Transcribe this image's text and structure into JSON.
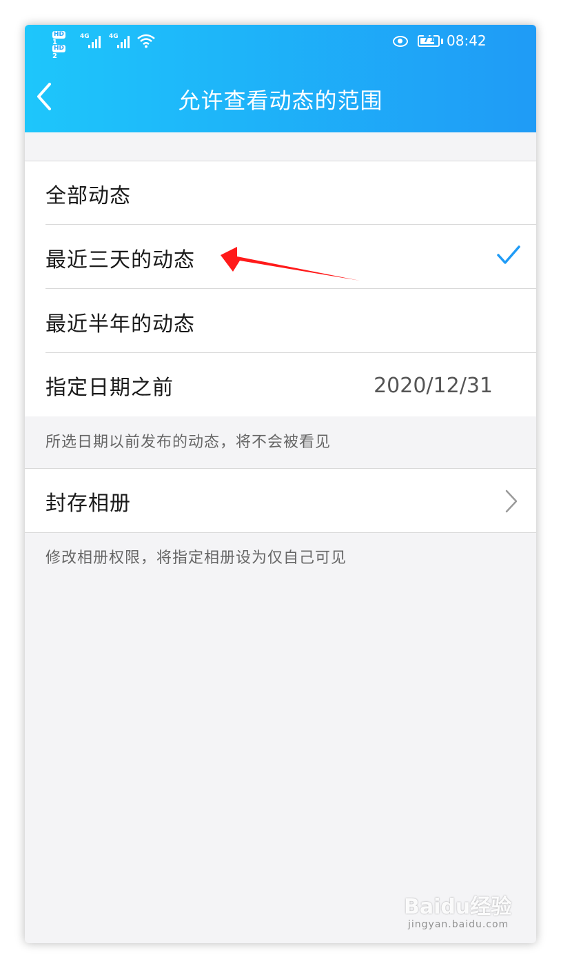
{
  "status_bar": {
    "hd_badge_1": "HD",
    "sim_1": "1",
    "hd_badge_2": "HD",
    "sim_2": "2",
    "network_1": "4G",
    "network_2": "4G",
    "battery_level": "71",
    "time": "08:42",
    "icons": [
      "signal-icon",
      "wifi-icon",
      "eye-icon",
      "battery-icon"
    ]
  },
  "header": {
    "back_icon": "chevron-left-icon",
    "title": "允许查看动态的范围",
    "gradient_start": "#1ec6fb",
    "gradient_end": "#1f9bf6"
  },
  "options": [
    {
      "label": "全部动态",
      "selected": false
    },
    {
      "label": "最近三天的动态",
      "selected": true
    },
    {
      "label": "最近半年的动态",
      "selected": false
    },
    {
      "label": "指定日期之前",
      "value": "2020/12/31",
      "selected": false
    }
  ],
  "date_note": "所选日期以前发布的动态，将不会被看见",
  "archive": {
    "label": "封存相册",
    "icon": "chevron-right-icon",
    "note": "修改相册权限，将指定相册设为仅自己可见"
  },
  "accent_color": "#1f9bf6",
  "annotation_arrow_color": "#ff1a1a",
  "watermark": {
    "logo": "Baidu经验",
    "url": "jingyan.baidu.com"
  }
}
